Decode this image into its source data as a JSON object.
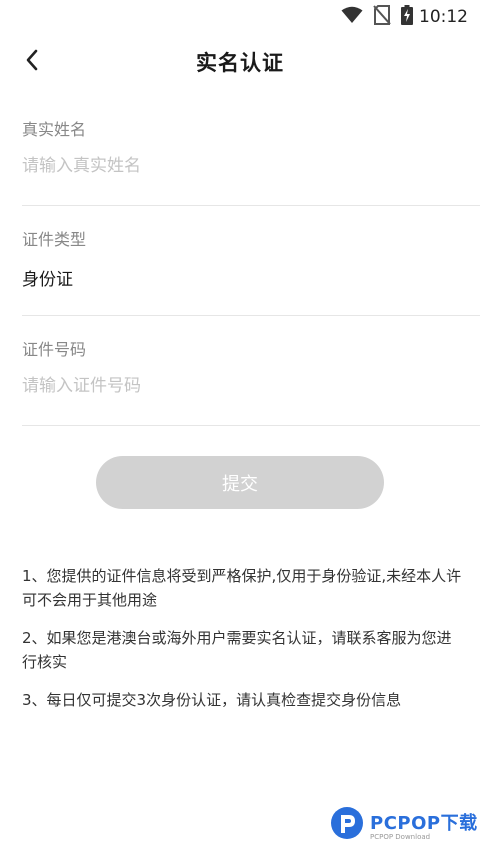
{
  "status_bar": {
    "time": "10:12",
    "icons": [
      "wifi-icon",
      "no-sim-icon",
      "battery-charging-icon"
    ]
  },
  "header": {
    "back_icon": "chevron-left-icon",
    "title": "实名认证"
  },
  "form": {
    "name": {
      "label": "真实姓名",
      "placeholder": "请输入真实姓名",
      "value": ""
    },
    "id_type": {
      "label": "证件类型",
      "value": "身份证"
    },
    "id_number": {
      "label": "证件号码",
      "placeholder": "请输入证件号码",
      "value": ""
    }
  },
  "submit": {
    "label": "提交",
    "enabled": false,
    "color": "#d2d2d2"
  },
  "notes": [
    "1、您提供的证件信息将受到严格保护,仅用于身份验证,未经本人许可不会用于其他用途",
    "2、如果您是港澳台或海外用户需要实名认证，请联系客服为您进行核实",
    "3、每日仅可提交3次身份认证，请认真检查提交身份信息"
  ],
  "watermark": {
    "main": "PCPOP下载",
    "sub": "PCPOP Download",
    "color": "#2a6fdb"
  }
}
